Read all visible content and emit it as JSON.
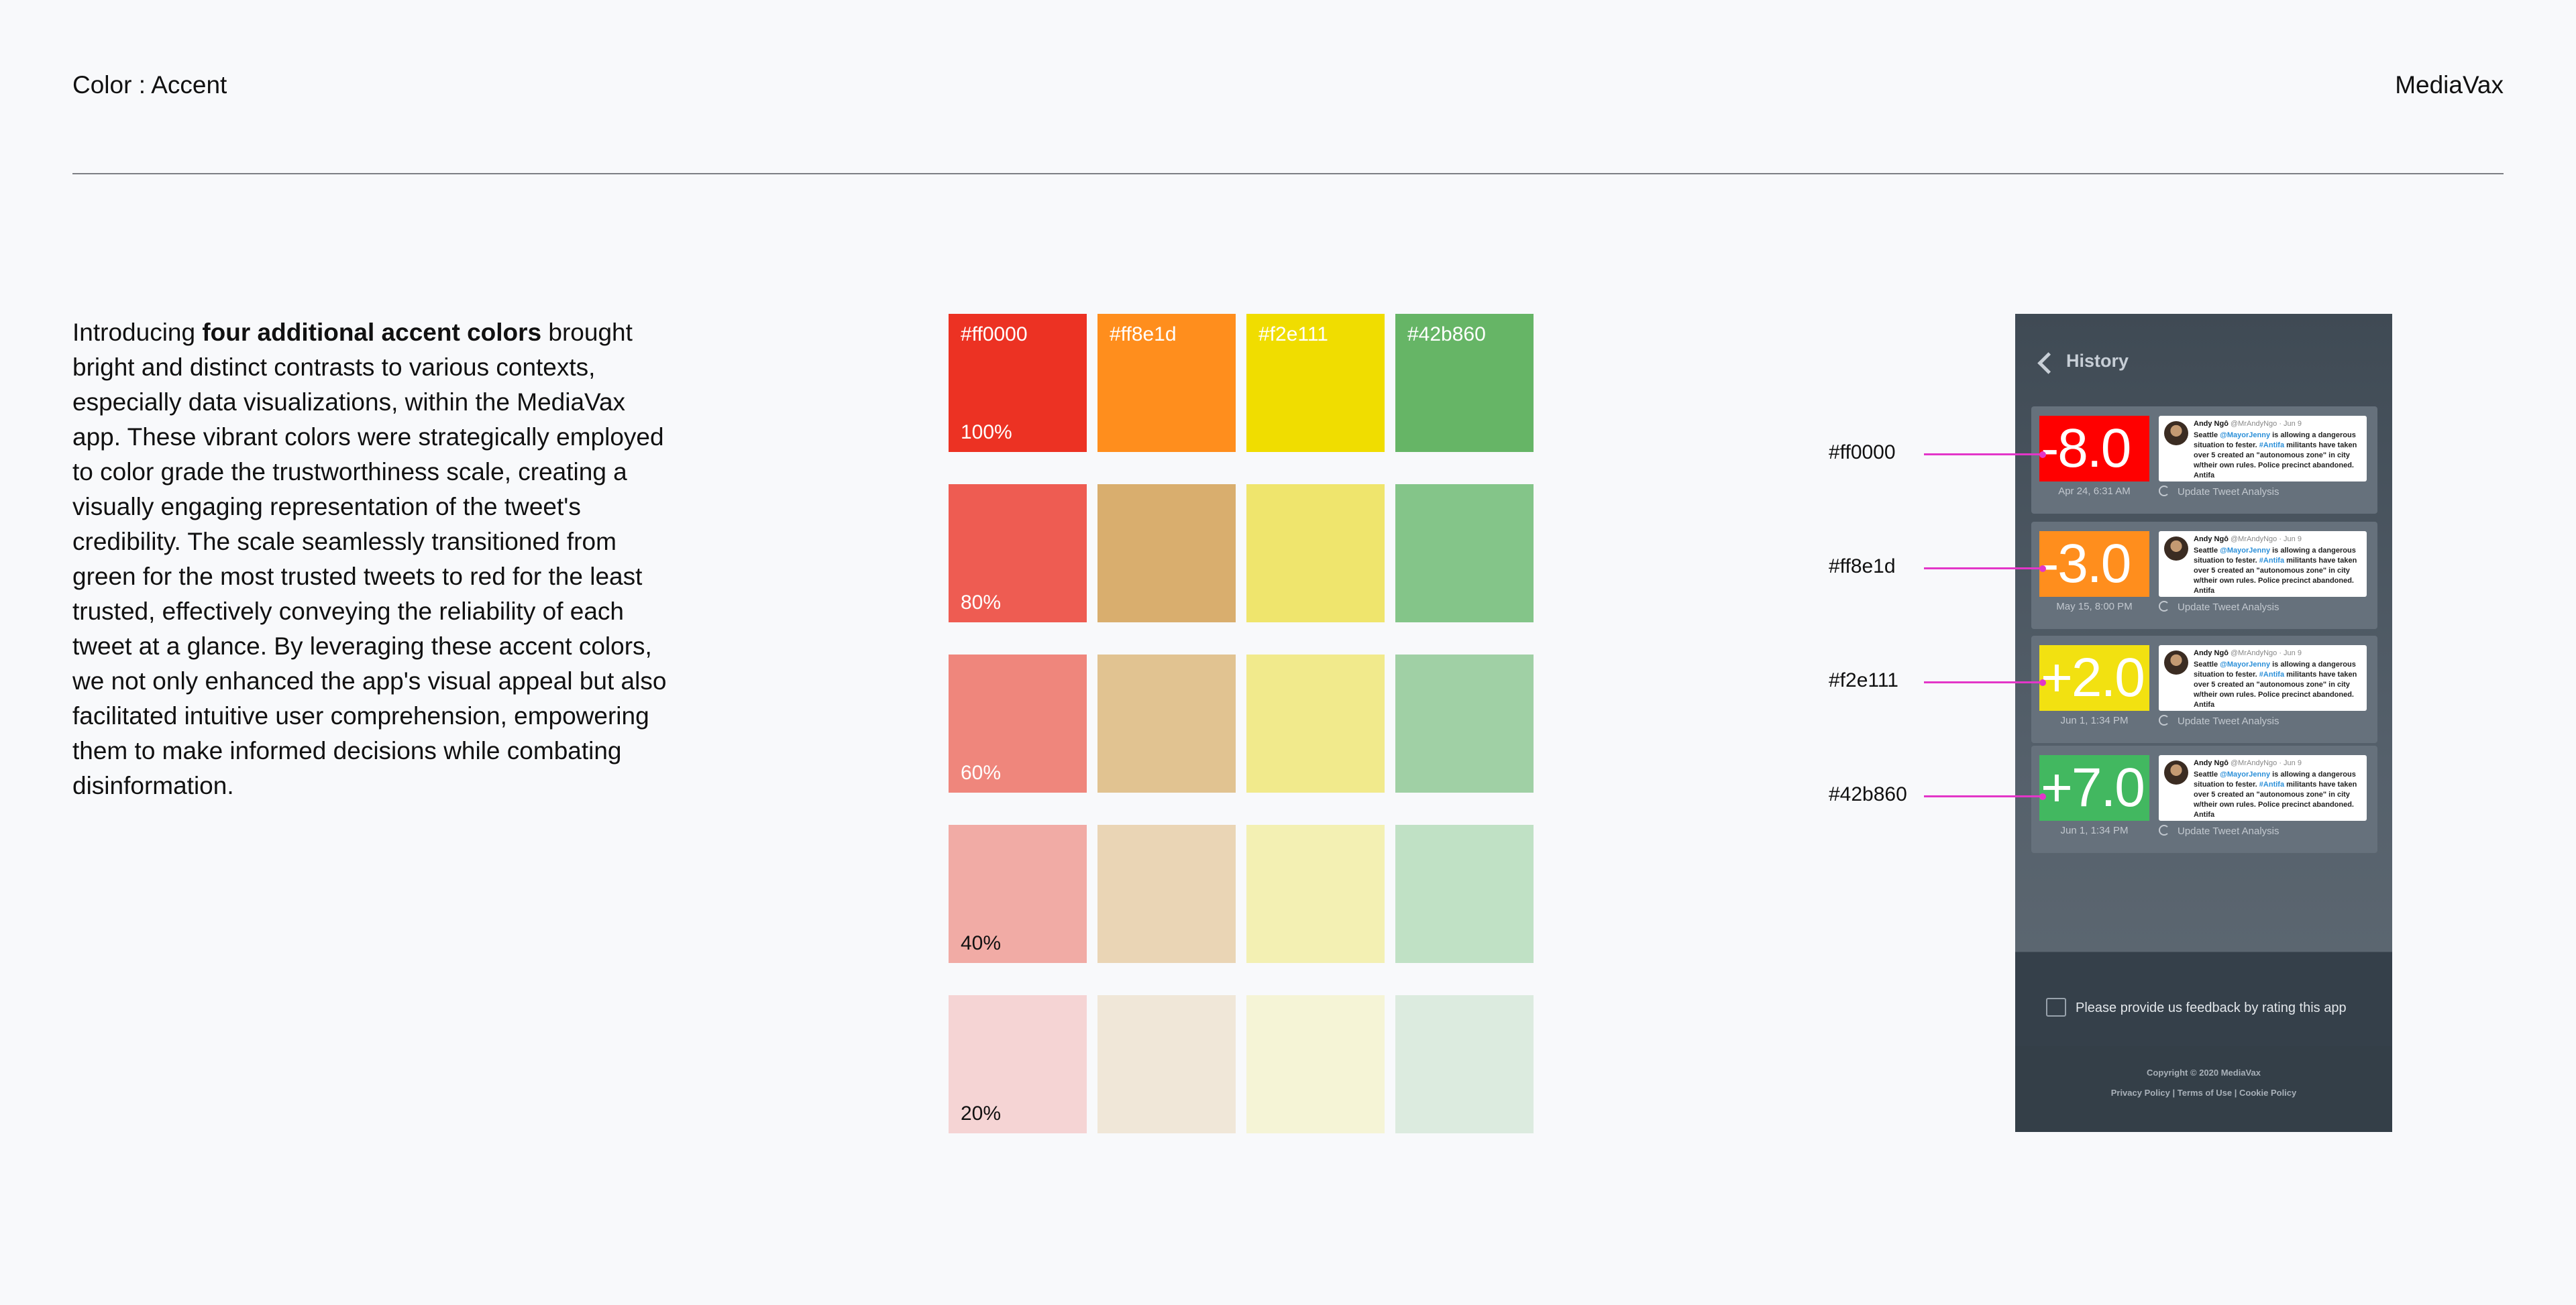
{
  "header": {
    "section": "Color : Accent",
    "brand": "MediaVax"
  },
  "intro": {
    "before": "Introducing ",
    "bold": "four additional accent colors",
    "after": " brought bright and distinct contrasts to various contexts, especially data visualizations, within the MediaVax app. These vibrant colors were strategically employed to color grade the trustworthiness scale, creating a visually engaging representation of the tweet's credibility. The scale seamlessly transitioned from green for the most trusted tweets to red for the least trusted, effectively conveying the reliability of each tweet at a glance. By leveraging these accent colors, we not only enhanced the app's visual appeal but also facilitated intuitive user comprehension, empowering them to make informed decisions while combating disinformation."
  },
  "palette": {
    "columns": [
      {
        "hex": "#ff0000",
        "rows": [
          "#ec3223",
          "#ee5c52",
          "#ef867c",
          "#f1aba5",
          "#f5d4d4"
        ]
      },
      {
        "hex": "#ff8e1d",
        "rows": [
          "#ff8e1d",
          "#d9ae6e",
          "#e1c391",
          "#ead5b5",
          "#f0e7d8"
        ]
      },
      {
        "hex": "#f2e111",
        "rows": [
          "#f0dd00",
          "#efe56d",
          "#f1ea8c",
          "#f3f0b3",
          "#f5f4d6"
        ]
      },
      {
        "hex": "#42b860",
        "rows": [
          "#66b566",
          "#84c589",
          "#a0d0a5",
          "#c0e1c5",
          "#dcebdf"
        ]
      }
    ],
    "percents": [
      "100%",
      "80%",
      "60%",
      "40%",
      "20%"
    ]
  },
  "phone": {
    "title": "History",
    "cards": [
      {
        "score": "-8.0",
        "color": "#ff0000",
        "date": "Apr 24, 6:31 AM"
      },
      {
        "score": "-3.0",
        "color": "#ff8e1d",
        "date": "May 15, 8:00 PM"
      },
      {
        "score": "+2.0",
        "color": "#f2e111",
        "date": "Jun 1, 1:34 PM"
      },
      {
        "score": "+7.0",
        "color": "#42b860",
        "date": "Jun 1, 1:34 PM"
      }
    ],
    "tweet": {
      "name": "Andy Ngô",
      "handle": "@MrAndyNgo · Jun 9",
      "body_a": "Seattle ",
      "mention": "@MayorJenny",
      "body_b": " is allowing a dangerous situation to fester. ",
      "tag": "#Antifa",
      "body_c": " militants have taken over 5 created an \"autonomous zone\" in city w/their own rules. Police precinct abandoned. Antifa"
    },
    "update_label": "Update Tweet Analysis",
    "feedback": "Please provide us feedback by rating this app",
    "copyright": "Copyright © 2020 MediaVax",
    "links": "Privacy Policy  |  Terms of Use  |  Cookie Policy"
  },
  "callouts": [
    "#ff0000",
    "#ff8e1d",
    "#f2e111",
    "#42b860"
  ]
}
